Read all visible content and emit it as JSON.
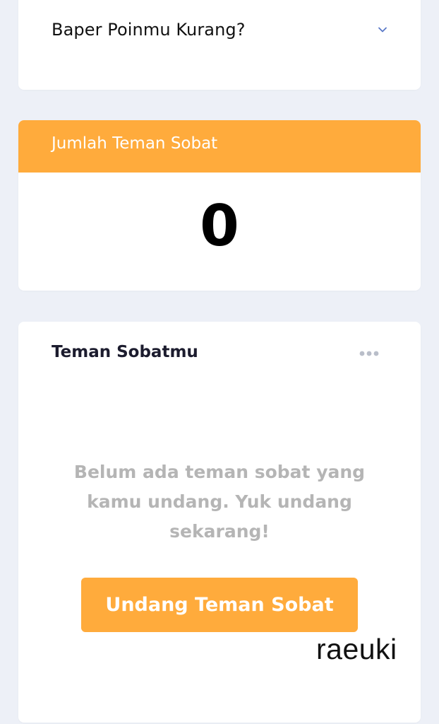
{
  "colors": {
    "accent": "#ffab3c",
    "background": "#edf0f7",
    "card": "#ffffff",
    "chevron": "#5a78c8",
    "muted_text": "#b5b5b5",
    "more_icon": "#b9bec9"
  },
  "faq": {
    "title": "Baper Poinmu Kurang?",
    "toggle_icon": "chevron-down-icon"
  },
  "friend_count": {
    "header": "Jumlah Teman Sobat",
    "value": "0"
  },
  "friends": {
    "title": "Teman Sobatmu",
    "more_icon": "more-horizontal-icon",
    "empty_message": "Belum ada teman sobat yang kamu undang. Yuk undang sekarang!",
    "invite_label": "Undang Teman Sobat"
  },
  "watermark": "raeuki"
}
